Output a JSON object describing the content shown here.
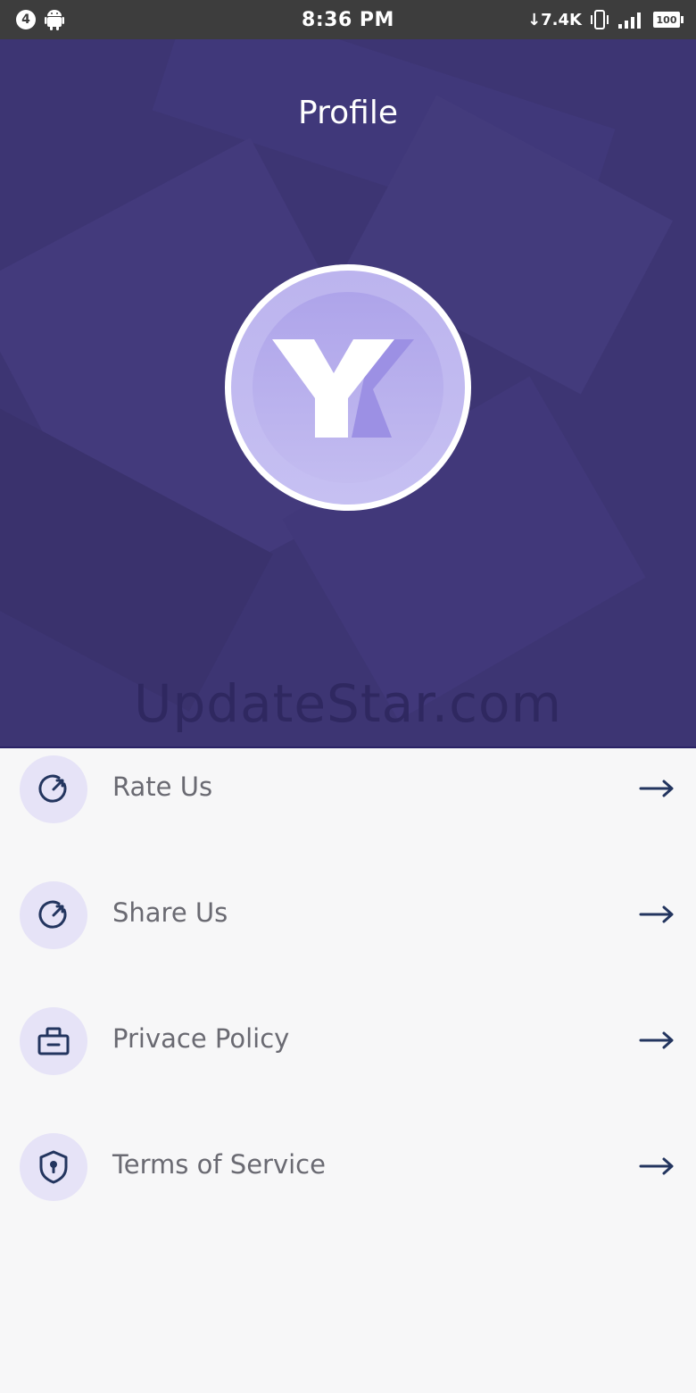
{
  "status_bar": {
    "notification_count": "4",
    "time": "8:36 PM",
    "net_speed": "↓7.4K",
    "battery_level": "100"
  },
  "header": {
    "title": "Profile",
    "background_color": "#3d3573",
    "watermark": "UpdateStar.com"
  },
  "menu": {
    "items": [
      {
        "label": "Rate Us",
        "icon": "gauge-icon"
      },
      {
        "label": "Share Us",
        "icon": "gauge-icon"
      },
      {
        "label": "Privace Policy",
        "icon": "briefcase-icon"
      },
      {
        "label": "Terms of Service",
        "icon": "shield-lock-icon"
      }
    ],
    "icon_bg_color": "#e6e3f7",
    "icon_color": "#23355f",
    "arrow_icon": "arrow-right-icon"
  }
}
